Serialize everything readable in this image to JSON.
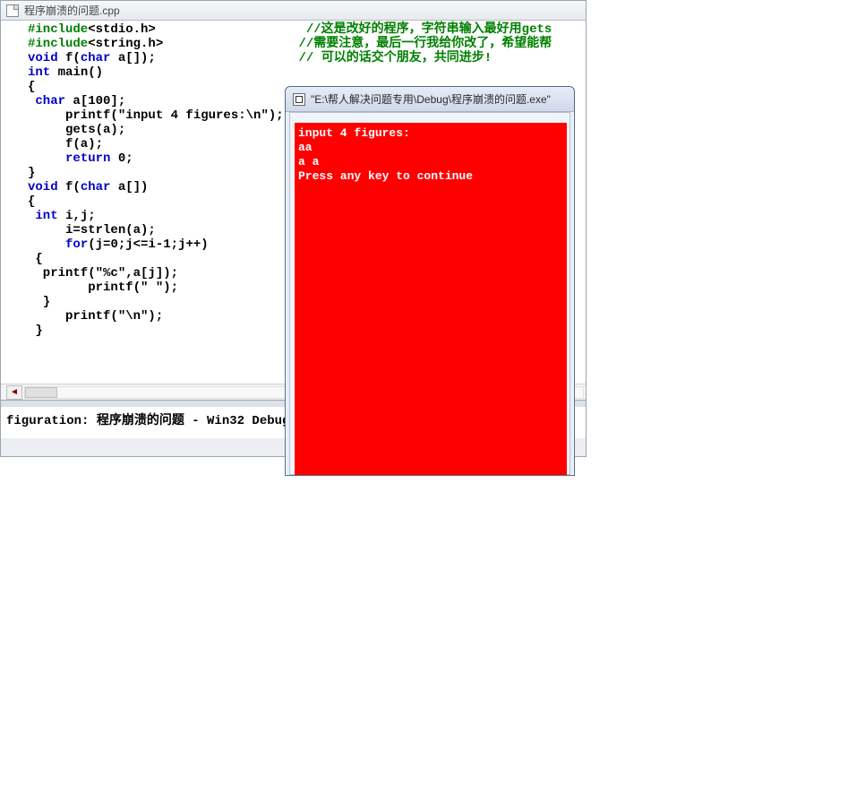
{
  "ide": {
    "tab_title": "程序崩溃的问题.cpp",
    "code_tokens": [
      [
        [
          "pp",
          "#include"
        ],
        [
          "plain",
          "<stdio.h>                    "
        ],
        [
          "comment",
          "//这是改好的程序，字符串输入最好用gets"
        ]
      ],
      [
        [
          "pp",
          "#include"
        ],
        [
          "plain",
          "<string.h>                  "
        ],
        [
          "comment",
          "//需要注意，最后一行我给你改了，希望能帮"
        ]
      ],
      [
        [
          "kw",
          "void"
        ],
        [
          "plain",
          " f("
        ],
        [
          "kw",
          "char"
        ],
        [
          "plain",
          " a[]);                   "
        ],
        [
          "comment",
          "// 可以的话交个朋友，共同进步!"
        ]
      ],
      [
        [
          "kw",
          "int"
        ],
        [
          "plain",
          " main()"
        ]
      ],
      [
        [
          "plain",
          "{"
        ]
      ],
      [
        [
          "plain",
          " "
        ],
        [
          "kw",
          "char"
        ],
        [
          "plain",
          " a[100];"
        ]
      ],
      [
        [
          "plain",
          "     printf(\"input 4 figures:\\n\");"
        ]
      ],
      [
        [
          "plain",
          "     gets(a);"
        ]
      ],
      [
        [
          "plain",
          "     f(a);"
        ]
      ],
      [
        [
          "plain",
          "     "
        ],
        [
          "kw",
          "return"
        ],
        [
          "plain",
          " 0;"
        ]
      ],
      [
        [
          "plain",
          "}"
        ]
      ],
      [
        [
          "kw",
          "void"
        ],
        [
          "plain",
          " f("
        ],
        [
          "kw",
          "char"
        ],
        [
          "plain",
          " a[])"
        ]
      ],
      [
        [
          "plain",
          "{"
        ]
      ],
      [
        [
          "plain",
          " "
        ],
        [
          "kw",
          "int"
        ],
        [
          "plain",
          " i,j;"
        ]
      ],
      [
        [
          "plain",
          "     i=strlen(a);"
        ]
      ],
      [
        [
          "plain",
          "     "
        ],
        [
          "kw",
          "for"
        ],
        [
          "plain",
          "(j=0;j<=i-1;j++)"
        ]
      ],
      [
        [
          "plain",
          " {"
        ]
      ],
      [
        [
          "plain",
          "  printf(\"%c\",a[j]);"
        ]
      ],
      [
        [
          "plain",
          "        printf(\" \");"
        ]
      ],
      [
        [
          "plain",
          "  }"
        ]
      ],
      [
        [
          "plain",
          "     printf(\"\\n\");"
        ]
      ],
      [
        [
          "plain",
          " }"
        ]
      ]
    ],
    "output_line": "figuration: 程序崩溃的问题 - Win32 Debug"
  },
  "console": {
    "title": "\"E:\\帮人解决问题专用\\Debug\\程序崩溃的问题.exe\"",
    "lines": [
      "input 4 figures:",
      "aa",
      "a a",
      "Press any key to continue"
    ]
  }
}
